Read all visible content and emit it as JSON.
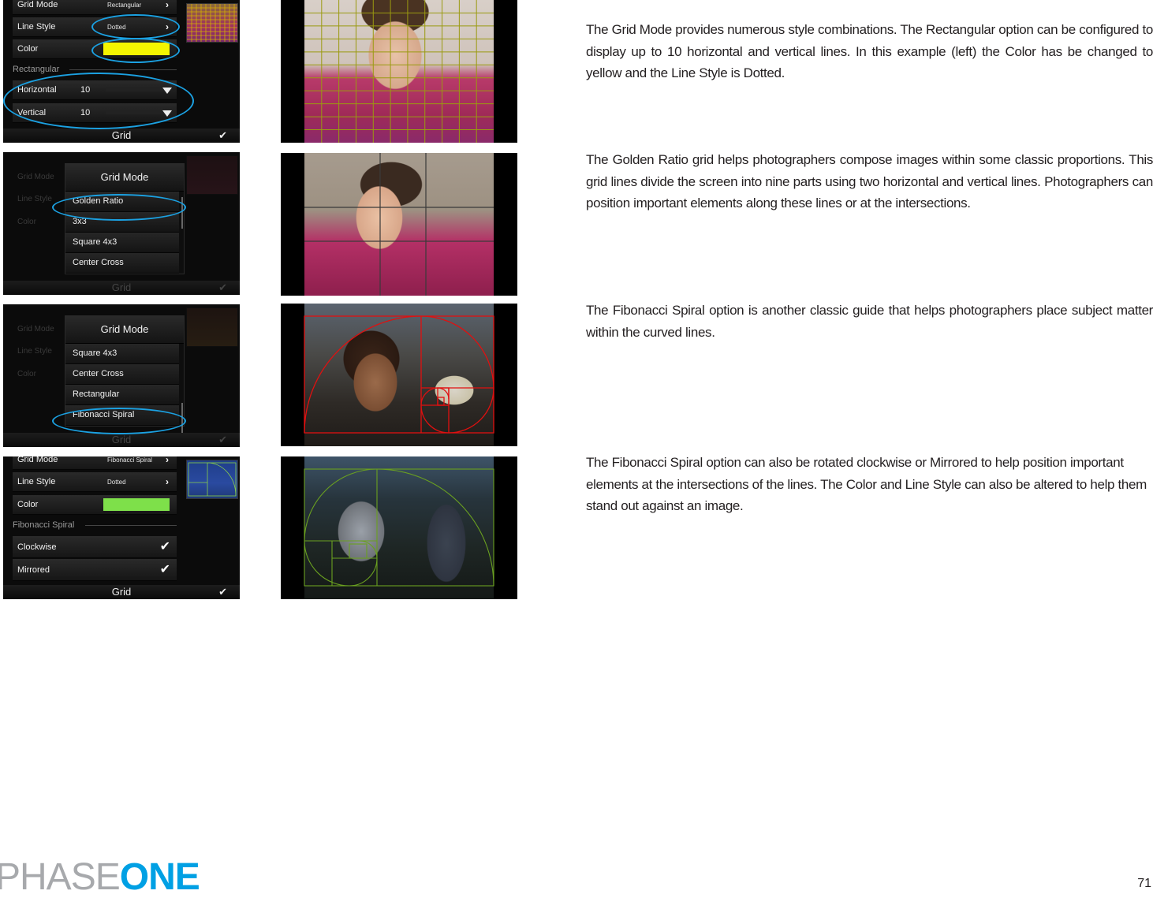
{
  "panels": [
    {
      "id": "rectangular-settings",
      "rows": {
        "grid_mode": {
          "label": "Grid Mode",
          "value": "Rectangular"
        },
        "line_style": {
          "label": "Line Style",
          "value": "Dotted"
        },
        "color": {
          "label": "Color",
          "swatch": "#f5f500"
        },
        "section": "Rectangular",
        "horizontal": {
          "label": "Horizontal",
          "value": "10"
        },
        "vertical": {
          "label": "Vertical",
          "value": "10"
        }
      },
      "footer": "Grid"
    },
    {
      "id": "grid-mode-popup-golden",
      "dim_menu": [
        "Grid Mode",
        "Line Style",
        "Color"
      ],
      "popup_title": "Grid Mode",
      "items": [
        "Golden Ratio",
        "3x3",
        "Square 4x3",
        "Center Cross"
      ],
      "highlighted": "Golden Ratio",
      "footer": "Grid"
    },
    {
      "id": "grid-mode-popup-fibonacci",
      "dim_menu": [
        "Grid Mode",
        "Line Style",
        "Color"
      ],
      "popup_title": "Grid Mode",
      "items": [
        "Square 4x3",
        "Center Cross",
        "Rectangular",
        "Fibonacci Spiral"
      ],
      "highlighted": "Fibonacci Spiral",
      "footer": "Grid"
    },
    {
      "id": "fibonacci-settings",
      "rows": {
        "grid_mode": {
          "label": "Grid Mode",
          "value": "Fibonacci Spiral"
        },
        "line_style": {
          "label": "Line Style",
          "value": "Dotted"
        },
        "color": {
          "label": "Color",
          "swatch": "#7ee04a"
        },
        "section": "Fibonacci Spiral",
        "clockwise": {
          "label": "Clockwise",
          "checked": true
        },
        "mirrored": {
          "label": "Mirrored",
          "checked": true
        }
      },
      "footer": "Grid"
    }
  ],
  "photos": [
    {
      "grid": "Rectangular",
      "horizontal_lines": 10,
      "vertical_lines": 10,
      "line_color": "#9a9a10"
    },
    {
      "grid": "Golden Ratio",
      "line_color": "#3a3a3a"
    },
    {
      "grid": "Fibonacci Spiral",
      "line_color": "#e01010"
    },
    {
      "grid": "Fibonacci Spiral (clockwise, mirrored)",
      "line_color": "#6aa020"
    }
  ],
  "paragraphs": [
    "The Grid Mode provides numerous style combinations.  The Rectangular option can be configured to display up to 10 horizontal and vertical lines. In this example (left) the Color has be changed to yellow and the Line Style is Dotted.",
    "The Golden Ratio grid helps photographers compose images within some classic proportions. This grid lines divide the screen into nine parts using two horizontal and vertical lines. Photographers can position important elements along these lines or at the intersections.",
    "The Fibonacci Spiral option is another classic guide that helps photographers place subject matter within the curved lines.",
    "The Fibonacci Spiral option can also be rotated clockwise or Mirrored to help position important elements at the intersections of the lines. The Color and Line Style can also be altered to help them stand out against an image."
  ],
  "footer": {
    "logo_part1": "PHASE",
    "logo_part2": "ONE",
    "page_number": "71"
  },
  "icons": {
    "chevron": "›",
    "check": "✔"
  },
  "highlight_color": "#1ba1e2"
}
